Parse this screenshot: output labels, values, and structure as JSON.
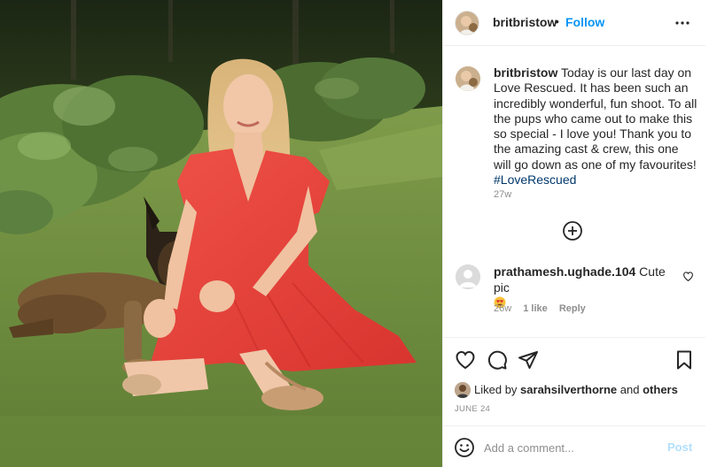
{
  "post": {
    "username": "britbristow",
    "separator": "•",
    "follow_label": "Follow",
    "more_icon": "more-horizontal-icon",
    "caption": {
      "username": "britbristow",
      "text": "Today is our last day on Love Rescued. It has been such an incredibly wonderful, fun shoot. To all the pups who came out to make this so special - I love you! Thank you to the amazing cast & crew, this one will go down as one of my favourites!",
      "hashtag": "#LoveRescued",
      "time": "27w"
    },
    "load_more_icon": "plus-circle-icon",
    "comments": [
      {
        "username": "prathamesh.ughade.104",
        "text": "Cute pic",
        "emoji": "heart-eyes-emoji",
        "time": "26w",
        "likes": "1 like",
        "reply_label": "Reply"
      }
    ],
    "actions": [
      "heart-icon",
      "comment-icon",
      "share-icon",
      "bookmark-icon"
    ],
    "liked_by": {
      "prefix": "Liked by",
      "user": "sarahsilverthorne",
      "and": "and",
      "others": "others"
    },
    "date": "JUNE 24",
    "comment_box": {
      "placeholder": "Add a comment...",
      "post_label": "Post"
    }
  },
  "colors": {
    "link_blue": "#0095f6",
    "hashtag_blue": "#00376b",
    "post_disabled": "#b2dffc",
    "muted_text": "#8e8e8e",
    "text": "#262626",
    "dress_red": "#e8463f"
  }
}
